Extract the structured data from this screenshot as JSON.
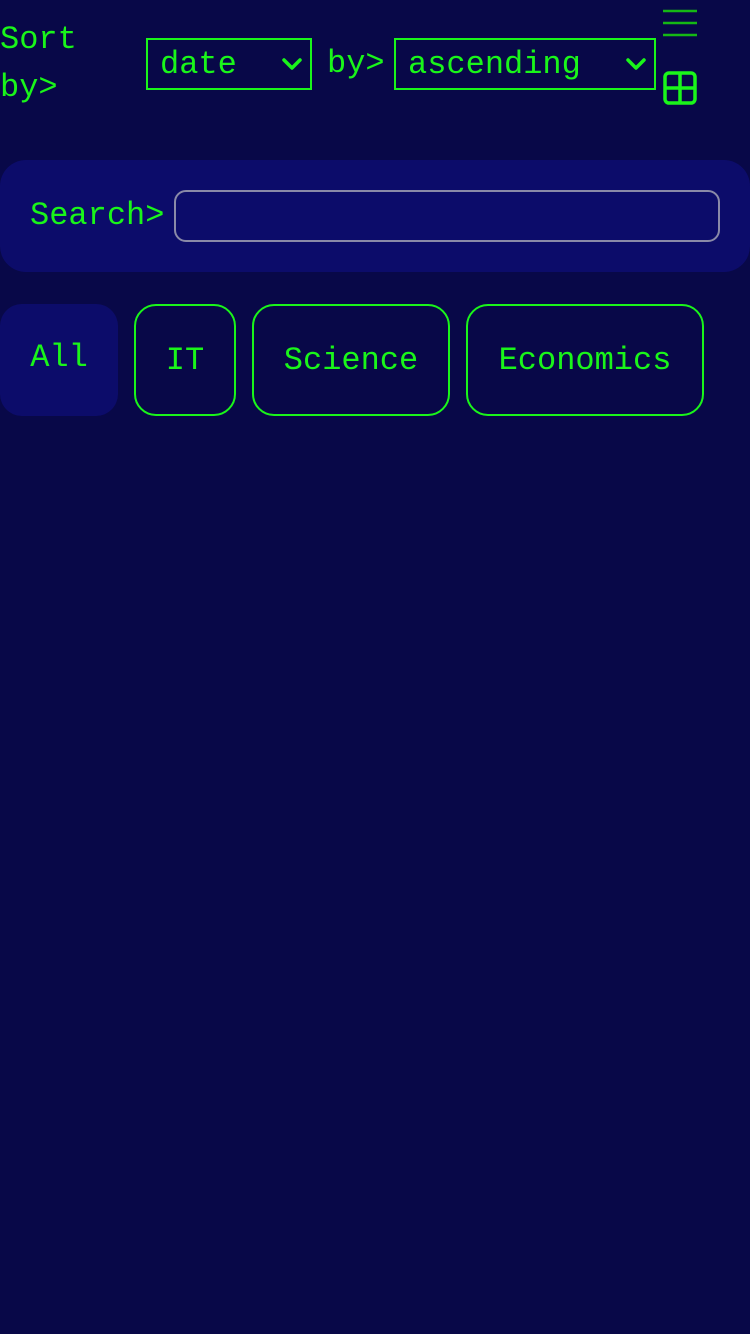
{
  "sort": {
    "label": "Sort by>",
    "field_value": "date",
    "order_label": "by>",
    "order_value": "ascending"
  },
  "icons": {
    "menu": "hamburger-menu-icon",
    "grid": "grid-view-icon",
    "dropdown": "chevron-down-icon"
  },
  "search": {
    "label": "Search>",
    "value": "",
    "placeholder": ""
  },
  "categories": {
    "items": [
      {
        "label": "All",
        "active": true
      },
      {
        "label": "IT",
        "active": false
      },
      {
        "label": "Science",
        "active": false
      },
      {
        "label": "Economics",
        "active": false
      }
    ]
  },
  "colors": {
    "background": "#080848",
    "panel": "#0c0c6a",
    "accent": "#1af51a",
    "input_border": "#8a8aa8"
  }
}
